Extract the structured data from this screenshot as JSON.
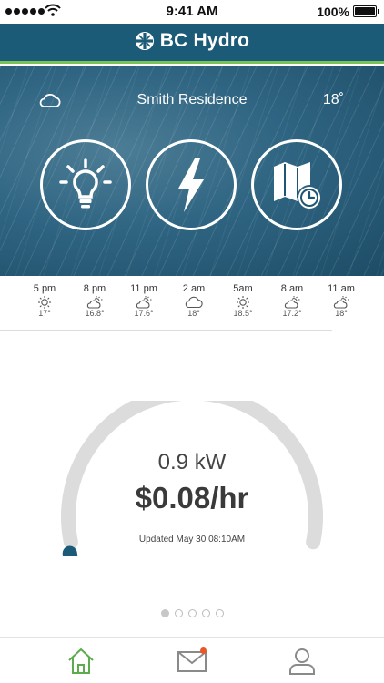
{
  "status_bar": {
    "time": "9:41 AM",
    "battery": "100%"
  },
  "header": {
    "brand": "BC Hydro"
  },
  "hero": {
    "location": "Smith Residence",
    "temperature": "18˚",
    "weather_icon": "cloud-icon"
  },
  "actions": [
    {
      "name": "lightbulb-icon"
    },
    {
      "name": "lightning-bolt-icon"
    },
    {
      "name": "map-clock-icon"
    }
  ],
  "forecast": [
    {
      "time": "5 pm",
      "icon": "sun",
      "temp": "17°"
    },
    {
      "time": "8 pm",
      "icon": "partly-cloudy",
      "temp": "16.8°"
    },
    {
      "time": "11 pm",
      "icon": "partly-cloudy",
      "temp": "17.6°"
    },
    {
      "time": "2 am",
      "icon": "cloud",
      "temp": "18°"
    },
    {
      "time": "5am",
      "icon": "sun",
      "temp": "18.5°"
    },
    {
      "time": "8 am",
      "icon": "partly-cloudy",
      "temp": "17.2°"
    },
    {
      "time": "11 am",
      "icon": "partly-cloudy",
      "temp": "18°"
    }
  ],
  "usage": {
    "power": "0.9 kW",
    "cost": "$0.08/hr",
    "updated": "Updated May 30 08:10AM",
    "gauge_fraction": 0.08
  },
  "pager": {
    "count": 5,
    "active": 0
  },
  "tabs": [
    {
      "name": "home-icon"
    },
    {
      "name": "mail-icon",
      "badge": true
    },
    {
      "name": "profile-icon"
    }
  ],
  "colors": {
    "brand": "#1c5b77",
    "accent": "#78c257",
    "gauge_fill": "#1c5b77",
    "gauge_track": "#dcdcdc",
    "badge": "#e8572a",
    "home_tab": "#5cab4e"
  }
}
